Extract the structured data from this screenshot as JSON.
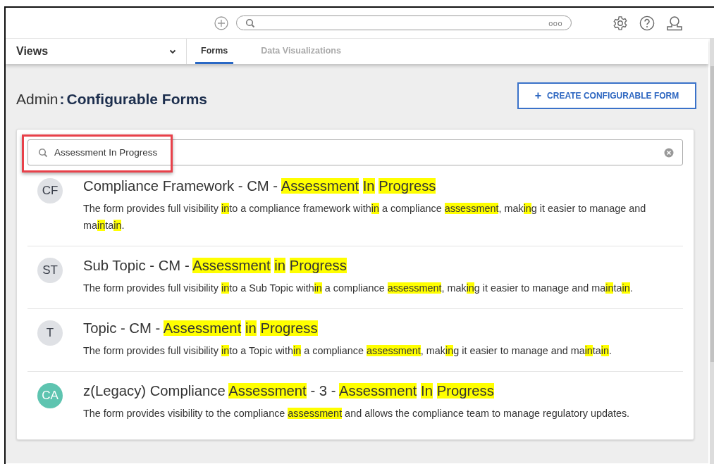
{
  "top_bar": {
    "search": {
      "more": "ooo"
    }
  },
  "views": {
    "label": "Views"
  },
  "tabs": [
    {
      "label": "Forms",
      "selected": true
    },
    {
      "label": "Data Visualizations",
      "selected": false
    }
  ],
  "page_title": {
    "section": "Admin",
    "separator": ":",
    "name": "Configurable Forms"
  },
  "create_button": {
    "icon": "+",
    "label": "CREATE CONFIGURABLE FORM"
  },
  "search": {
    "value": "Assessment In Progress",
    "callout": true
  },
  "forms": [
    {
      "initials": "CF",
      "color": "#dfe1e5",
      "title": [
        {
          "text": "Compliance Framework - CM - ",
          "highlighted": false
        },
        {
          "text": "Assessment",
          "highlighted": true,
          "space_after": true
        },
        {
          "text": "In",
          "highlighted": true,
          "space_after": true
        },
        {
          "text": "Progress",
          "highlighted": true
        }
      ],
      "description": [
        {
          "text": "The form provides full visibility ",
          "highlighted": false
        },
        {
          "text": "in",
          "highlighted": true
        },
        {
          "text": "to a compliance framework with",
          "highlighted": false
        },
        {
          "text": "in",
          "highlighted": true
        },
        {
          "text": " a compliance ",
          "highlighted": false
        },
        {
          "text": "assessment",
          "highlighted": true
        },
        {
          "text": ", mak",
          "highlighted": false
        },
        {
          "text": "in",
          "highlighted": true
        },
        {
          "text": "g it easier to manage and ma",
          "highlighted": false
        },
        {
          "text": "in",
          "highlighted": true
        },
        {
          "text": "ta",
          "highlighted": false
        },
        {
          "text": "in",
          "highlighted": true
        },
        {
          "text": ".",
          "highlighted": false
        }
      ]
    },
    {
      "initials": "ST",
      "color": "#dfe1e5",
      "title": [
        {
          "text": "Sub Topic - CM - ",
          "highlighted": false
        },
        {
          "text": "Assessment",
          "highlighted": true,
          "space_after": true
        },
        {
          "text": "in",
          "highlighted": true,
          "space_after": true
        },
        {
          "text": "Progress",
          "highlighted": true
        }
      ],
      "description": [
        {
          "text": "The form provides full visibility ",
          "highlighted": false
        },
        {
          "text": "in",
          "highlighted": true
        },
        {
          "text": "to a Sub Topic with",
          "highlighted": false
        },
        {
          "text": "in",
          "highlighted": true
        },
        {
          "text": " a compliance ",
          "highlighted": false
        },
        {
          "text": "assessment",
          "highlighted": true
        },
        {
          "text": ", mak",
          "highlighted": false
        },
        {
          "text": "in",
          "highlighted": true
        },
        {
          "text": "g it easier to manage and ma",
          "highlighted": false
        },
        {
          "text": "in",
          "highlighted": true
        },
        {
          "text": "ta",
          "highlighted": false
        },
        {
          "text": "in",
          "highlighted": true
        },
        {
          "text": ".",
          "highlighted": false
        }
      ]
    },
    {
      "initials": "T",
      "color": "#dfe1e5",
      "title": [
        {
          "text": "Topic - CM - ",
          "highlighted": false
        },
        {
          "text": "Assessment",
          "highlighted": true,
          "space_after": true
        },
        {
          "text": "in",
          "highlighted": true,
          "space_after": true
        },
        {
          "text": "Progress",
          "highlighted": true
        }
      ],
      "description": [
        {
          "text": "The form provides full visibility ",
          "highlighted": false
        },
        {
          "text": "in",
          "highlighted": true
        },
        {
          "text": "to a Topic with",
          "highlighted": false
        },
        {
          "text": "in",
          "highlighted": true
        },
        {
          "text": " a compliance ",
          "highlighted": false
        },
        {
          "text": "assessment",
          "highlighted": true
        },
        {
          "text": ", mak",
          "highlighted": false
        },
        {
          "text": "in",
          "highlighted": true
        },
        {
          "text": "g it easier to manage and ma",
          "highlighted": false
        },
        {
          "text": "in",
          "highlighted": true
        },
        {
          "text": "ta",
          "highlighted": false
        },
        {
          "text": "in",
          "highlighted": true
        },
        {
          "text": ".",
          "highlighted": false
        }
      ]
    },
    {
      "initials": "CA",
      "color": "#5ec4b0",
      "title": [
        {
          "text": "z(Legacy) Compliance ",
          "highlighted": false
        },
        {
          "text": "Assessment",
          "highlighted": true
        },
        {
          "text": " - 3 - ",
          "highlighted": false
        },
        {
          "text": "Assessment",
          "highlighted": true,
          "space_after": true
        },
        {
          "text": "In",
          "highlighted": true,
          "space_after": true
        },
        {
          "text": "Progress",
          "highlighted": true
        }
      ],
      "description": [
        {
          "text": "The form provides visibility to the compliance ",
          "highlighted": false
        },
        {
          "text": "assessment",
          "highlighted": true
        },
        {
          "text": " and allows the compliance team to manage regulatory updates.",
          "highlighted": false
        }
      ]
    }
  ]
}
